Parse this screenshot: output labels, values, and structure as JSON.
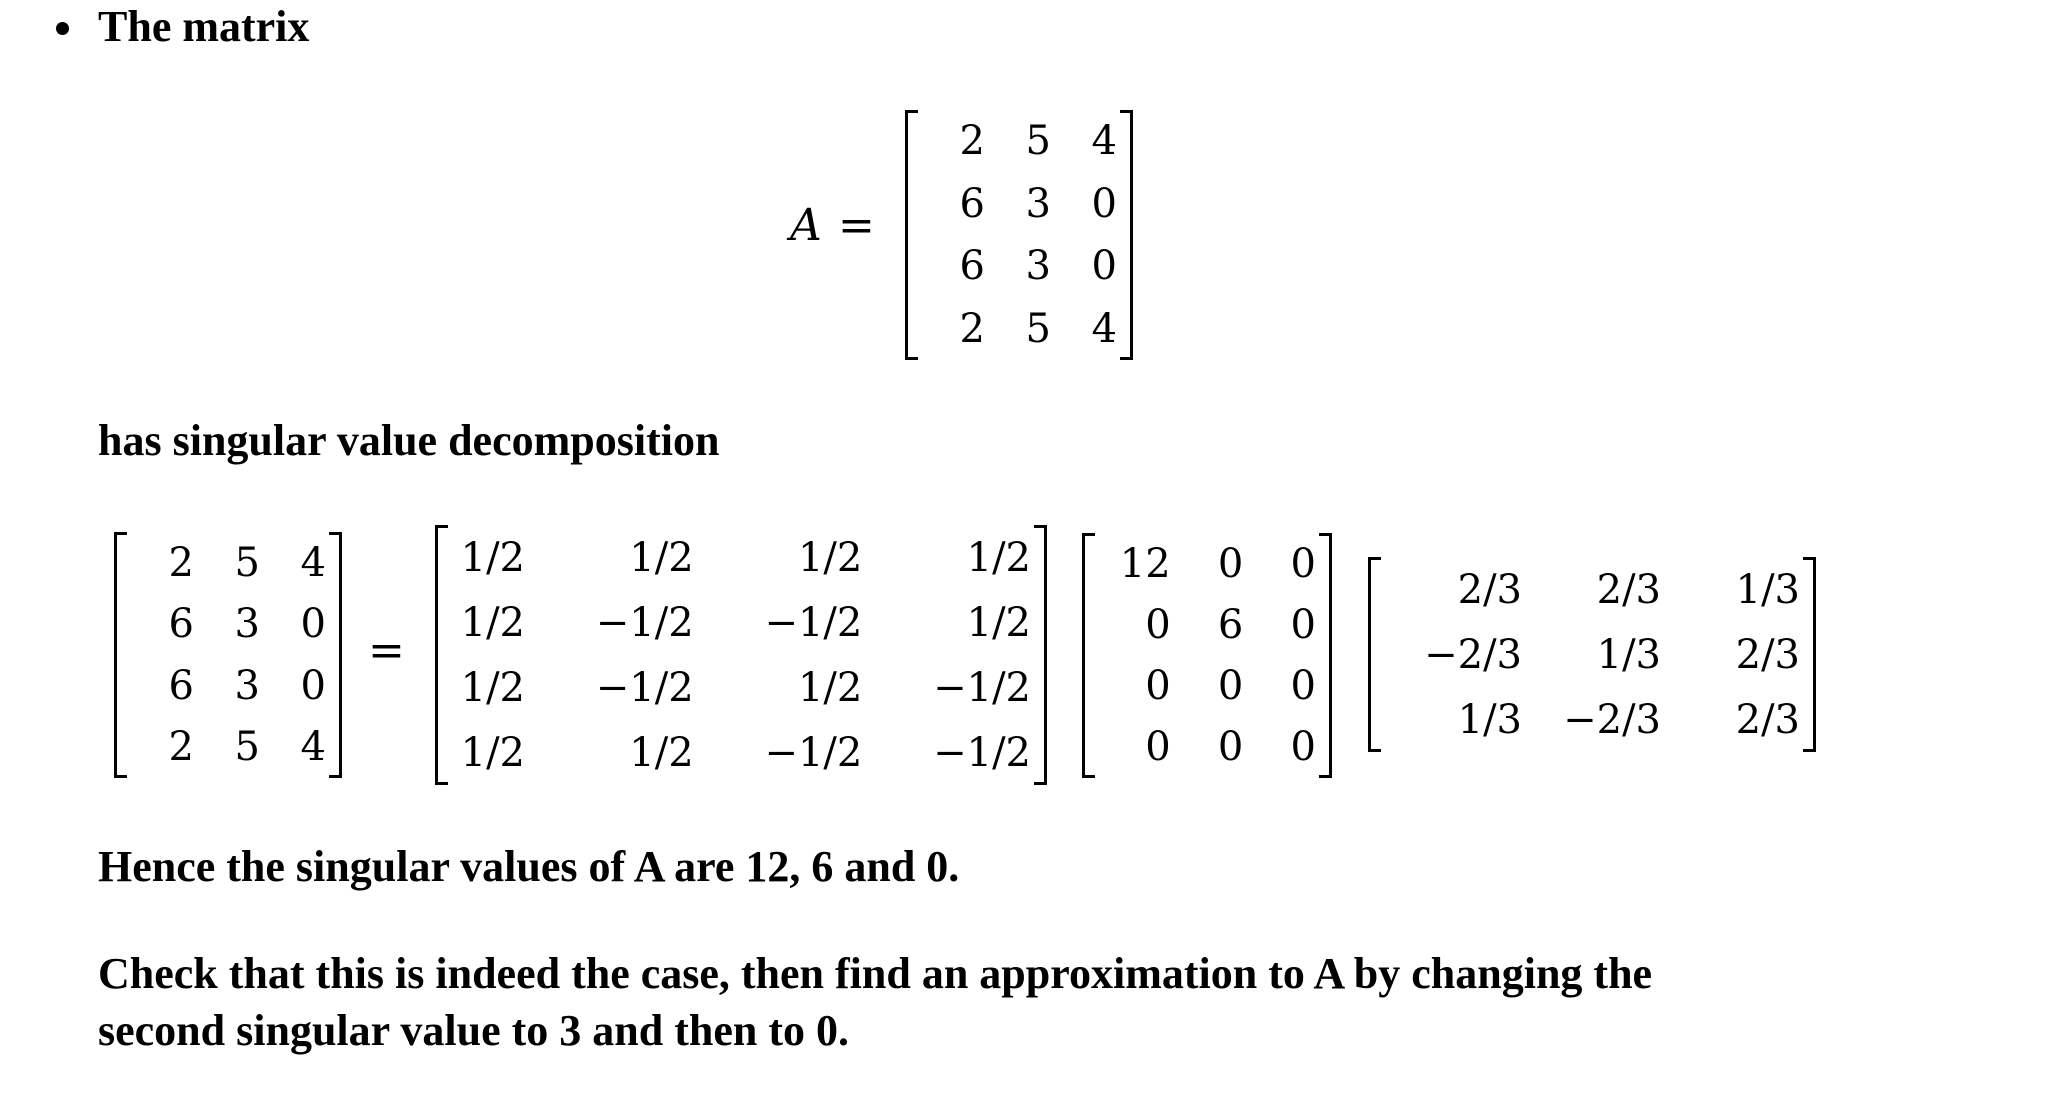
{
  "intro": {
    "bullet_text": "The matrix",
    "lhs_label": "A",
    "equals": "=",
    "matrix_A": [
      [
        "2",
        "5",
        "4"
      ],
      [
        "6",
        "3",
        "0"
      ],
      [
        "6",
        "3",
        "0"
      ],
      [
        "2",
        "5",
        "4"
      ]
    ]
  },
  "svd_intro": "has singular value decomposition",
  "svd": {
    "equals": "=",
    "A": [
      [
        "2",
        "5",
        "4"
      ],
      [
        "6",
        "3",
        "0"
      ],
      [
        "6",
        "3",
        "0"
      ],
      [
        "2",
        "5",
        "4"
      ]
    ],
    "U": [
      [
        "1/2",
        "1/2",
        "1/2",
        "1/2"
      ],
      [
        "1/2",
        "−1/2",
        "−1/2",
        "1/2"
      ],
      [
        "1/2",
        "−1/2",
        "1/2",
        "−1/2"
      ],
      [
        "1/2",
        "1/2",
        "−1/2",
        "−1/2"
      ]
    ],
    "Sigma": [
      [
        "12",
        "0",
        "0"
      ],
      [
        "0",
        "6",
        "0"
      ],
      [
        "0",
        "0",
        "0"
      ],
      [
        "0",
        "0",
        "0"
      ]
    ],
    "VT": [
      [
        "2/3",
        "2/3",
        "1/3"
      ],
      [
        "−2/3",
        "1/3",
        "2/3"
      ],
      [
        "1/3",
        "−2/3",
        "2/3"
      ]
    ]
  },
  "conclusion": "Hence the singular values of A are 12, 6 and 0.",
  "task": {
    "line1": "Check that this is indeed the case, then find an approximation to A by changing the",
    "line2": "second singular value to 3 and then to 0."
  }
}
